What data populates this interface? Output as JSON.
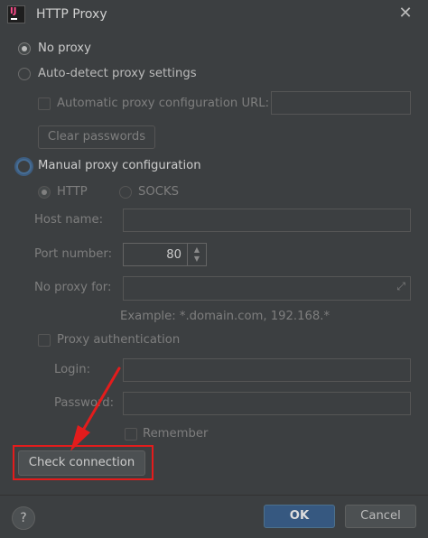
{
  "window": {
    "title": "HTTP Proxy"
  },
  "options": {
    "no_proxy": "No proxy",
    "auto_detect": "Auto-detect proxy settings",
    "auto_config_url": "Automatic proxy configuration URL:",
    "clear_passwords": "Clear passwords",
    "manual": "Manual proxy configuration",
    "http": "HTTP",
    "socks": "SOCKS"
  },
  "manual_fields": {
    "host_label": "Host name:",
    "port_label": "Port number:",
    "port_value": "80",
    "no_proxy_label": "No proxy for:",
    "example": "Example: *.domain.com, 192.168.*"
  },
  "auth": {
    "label": "Proxy authentication",
    "login_label": "Login:",
    "password_label": "Password:",
    "remember": "Remember"
  },
  "buttons": {
    "check_connection": "Check connection",
    "ok": "OK",
    "cancel": "Cancel",
    "help": "?"
  },
  "icons": {
    "app": "intellij-app-icon",
    "close": "close-icon",
    "expand": "expand-icon",
    "spinner": "spinner-arrows-icon"
  },
  "colors": {
    "background": "#3c3f41",
    "primary_button": "#365880",
    "annotation_red": "#e31c1c"
  }
}
